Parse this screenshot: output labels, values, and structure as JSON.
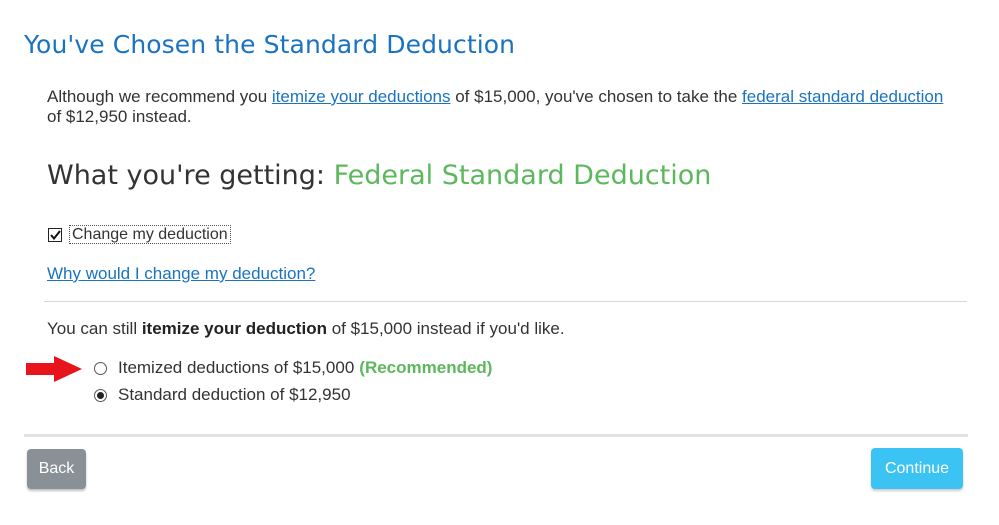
{
  "page": {
    "title": "You've Chosen the Standard Deduction"
  },
  "intro": {
    "text_1": "Although we recommend you ",
    "link_itemize": "itemize your deductions",
    "text_2": " of $15,000, you've chosen to take the ",
    "link_standard": "federal standard deduction",
    "text_3": " of $12,950 instead."
  },
  "getting": {
    "label": "What you're getting:",
    "value": "Federal Standard Deduction",
    "value_color": "#5cb85c"
  },
  "change_deduction": {
    "label": "Change my deduction",
    "checked": true
  },
  "why_link": "Why would I change my deduction?",
  "still": {
    "text_1": "You can still ",
    "bold": "itemize your deduction",
    "text_2": " of $15,000 instead if you'd like."
  },
  "options": [
    {
      "label": "Itemized deductions of $15,000",
      "badge": "(Recommended)",
      "selected": false
    },
    {
      "label": "Standard deduction of $12,950",
      "badge": "",
      "selected": true
    }
  ],
  "buttons": {
    "back": "Back",
    "continue": "Continue"
  },
  "colors": {
    "accent": "#1a73c1",
    "recommended": "#5cb85c",
    "continue_bg": "#3bc3f4",
    "back_bg": "#8a9196",
    "annotation_arrow": "#e8141b"
  }
}
